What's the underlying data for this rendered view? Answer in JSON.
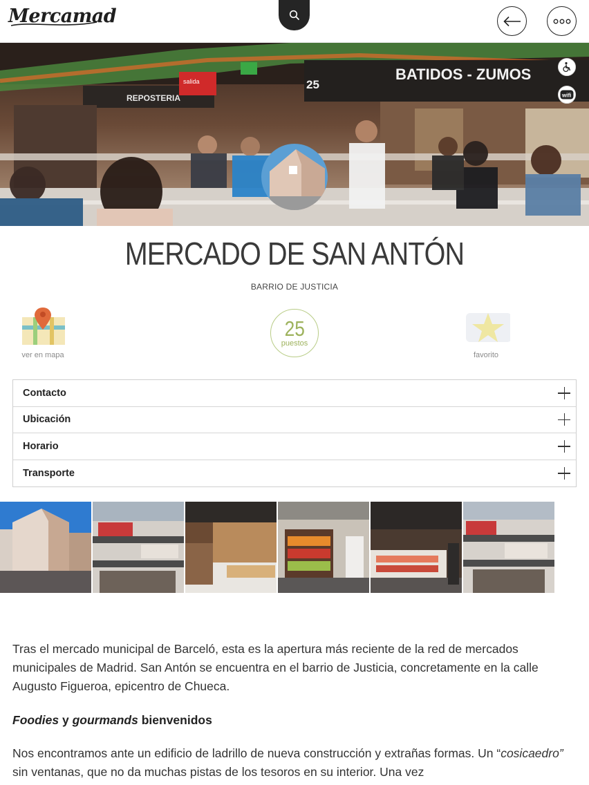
{
  "app": {
    "logo_text": "Mercamad"
  },
  "header": {
    "search_icon": "search-icon",
    "back_icon": "arrow-left-icon",
    "more_icon": "more-dots-icon"
  },
  "hero": {
    "badges": [
      "wheelchair-accessible-icon",
      "wifi-icon"
    ],
    "signs": {
      "shop": "BATIDOS - ZUMOS",
      "stall_number": "25",
      "left_shop": "REPOSTERIA",
      "exit": "salida"
    }
  },
  "market": {
    "name": "MERCADO DE SAN ANTÓN",
    "neighborhood": "BARRIO DE JUSTICIA"
  },
  "quick_actions": {
    "map_label": "ver en mapa",
    "stalls_count": "25",
    "stalls_label": "puestos",
    "favorite_label": "favorito"
  },
  "accordion": [
    {
      "label": "Contacto"
    },
    {
      "label": "Ubicación"
    },
    {
      "label": "Horario"
    },
    {
      "label": "Transporte"
    }
  ],
  "article": {
    "paragraph1": "Tras el mercado municipal de Barceló, esta es la apertura más reciente de la red de mercados municipales de Madrid. San Antón se encuentra en el barrio de Justicia, concretamente en la calle Augusto Figueroa, epicentro de Chueca.",
    "heading_part1": "Foodies",
    "heading_part2": " y ",
    "heading_part3": "gourmands",
    "heading_part4": " bienvenidos",
    "paragraph2_start": "Nos encontramos ante un edificio de ladrillo de nueva construcción y extrañas formas. Un “",
    "paragraph2_italic": "cosicaedro”",
    "paragraph2_end": " sin ventanas, que no da muchas pistas de los tesoros en su interior. Una vez"
  },
  "colors": {
    "accent_green": "#9db25c",
    "header_dark": "#252525"
  }
}
